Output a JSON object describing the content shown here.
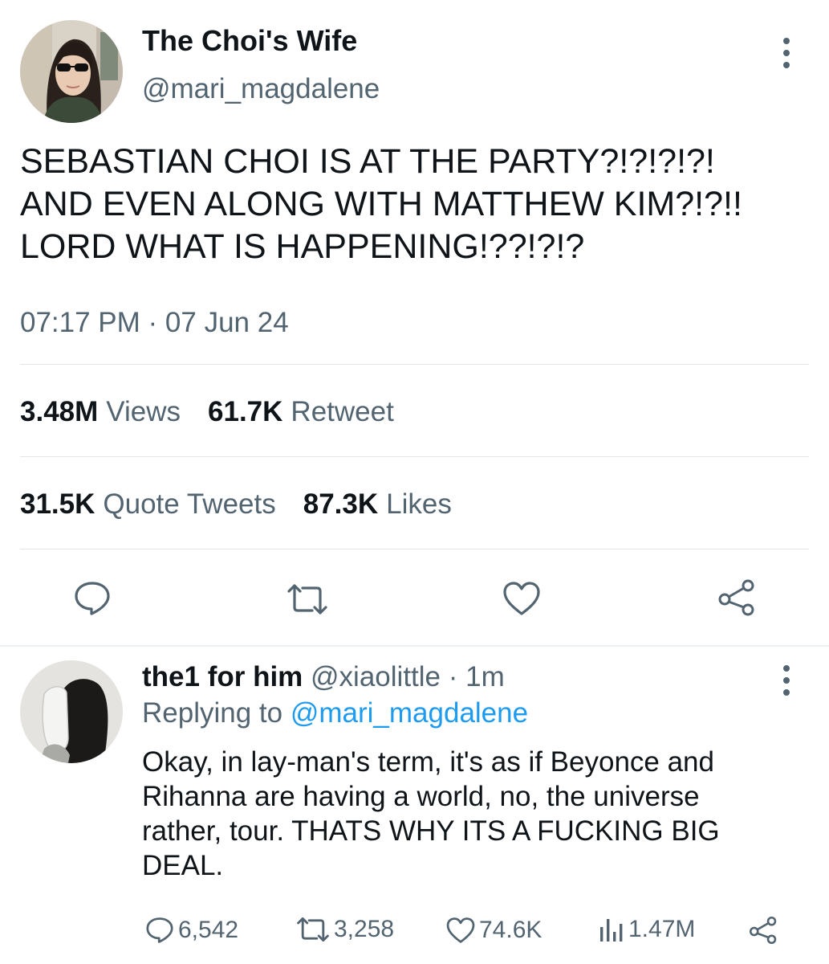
{
  "tweet": {
    "display_name": "The Choi's Wife",
    "handle": "@mari_magdalene",
    "text_lines": [
      "SEBASTIAN CHOI IS AT THE PARTY?!?!?!?!",
      "AND EVEN ALONG WITH MATTHEW KIM?!?!!",
      "LORD WHAT IS HAPPENING!??!?!?"
    ],
    "timestamp": "07:17 PM · 07 Jun 24",
    "stats": {
      "views_count": "3.48M",
      "views_label": "Views",
      "retweets_count": "61.7K",
      "retweets_label": "Retweet",
      "quotes_count": "31.5K",
      "quotes_label": "Quote Tweets",
      "likes_count": "87.3K",
      "likes_label": "Likes"
    },
    "icons": [
      "reply-icon",
      "retweet-icon",
      "heart-icon",
      "share-icon",
      "more-menu-icon"
    ]
  },
  "reply": {
    "display_name": "the1 for him",
    "handle": "@xiaolittle",
    "separator": "·",
    "time": "1m",
    "replying_prefix": "Replying to",
    "replying_handle": "@mari_magdalene",
    "text_lines": [
      "Okay, in lay-man's term, it's as if Beyonce and",
      "Rihanna are having a world, no, the universe",
      "rather, tour. THATS WHY ITS A FUCKING BIG",
      "DEAL."
    ],
    "counts": {
      "replies": "6,542",
      "retweets": "3,258",
      "likes": "74.6K",
      "views": "1.47M"
    }
  },
  "colors": {
    "text": "#0f1419",
    "muted": "#536471",
    "link": "#1d9bf0",
    "divider": "#e1e6ea"
  }
}
